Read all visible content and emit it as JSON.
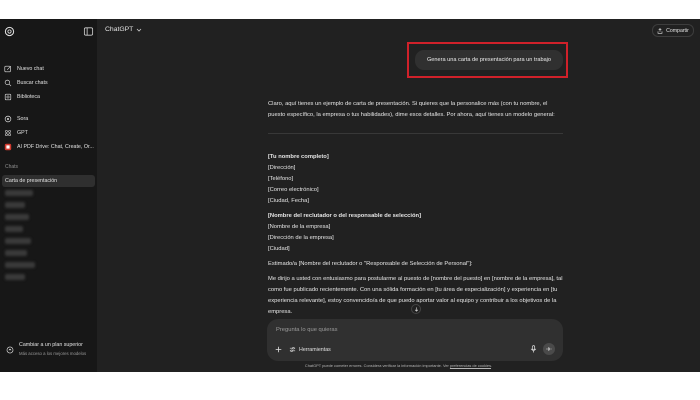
{
  "sidebar": {
    "top_items": [
      {
        "label": "Nuevo chat",
        "icon": "new-chat-icon"
      },
      {
        "label": "Buscar chats",
        "icon": "search-icon"
      },
      {
        "label": "Biblioteca",
        "icon": "library-icon"
      }
    ],
    "app_items": [
      {
        "label": "Sora",
        "icon": "sora-icon"
      },
      {
        "label": "GPT",
        "icon": "gpt-icon"
      },
      {
        "label": "AI PDF Drive: Chat, Create, Or...",
        "icon": "pdf-drive-icon"
      }
    ],
    "chats_label": "Chats",
    "active_chat": "Carta de presentación",
    "upgrade": {
      "title": "Cambiar a un plan superior",
      "subtitle": "Más acceso a los mejores modelos"
    }
  },
  "header": {
    "model": "ChatGPT",
    "share": "Compartir"
  },
  "conversation": {
    "user_message": "Genera una carta de presentación para un trabajo",
    "intro": "Claro, aquí tienes un ejemplo de carta de presentación. Si quieres que la personalice más (con tu nombre, el puesto específico, la empresa o tus habilidades), dime esos detalles. Por ahora, aquí tienes un modelo general:",
    "sender_block": [
      "[Tu nombre completo]",
      "[Dirección]",
      "[Teléfono]",
      "[Correo electrónico]",
      "[Ciudad, Fecha]"
    ],
    "recipient_block": [
      "[Nombre del reclutador o del responsable de selección]",
      "[Nombre de la empresa]",
      "[Dirección de la empresa]",
      "[Ciudad]"
    ],
    "salutation": "Estimado/a [Nombre del reclutador o \"Responsable de Selección de Personal\"]:",
    "body": "Me dirijo a usted con entusiasmo para postularme al puesto de [nombre del puesto] en [nombre de la empresa], tal como fue publicado recientemente. Con una sólida formación en [tu área de especialización] y experiencia en [tu experiencia relevante], estoy convencido/a de que puedo aportar valor al equipo y contribuir a los objetivos de la empresa."
  },
  "composer": {
    "placeholder": "Pregunta lo que quieras",
    "tools_label": "Herramientas"
  },
  "footer": {
    "text": "ChatGPT puede cometer errores. Considera verificar la información importante. Ver ",
    "link": "preferencias de cookies",
    "end": "."
  },
  "colors": {
    "sidebar_bg": "#171717",
    "main_bg": "#212121",
    "bubble_bg": "#303030",
    "highlight": "#d0212a"
  }
}
